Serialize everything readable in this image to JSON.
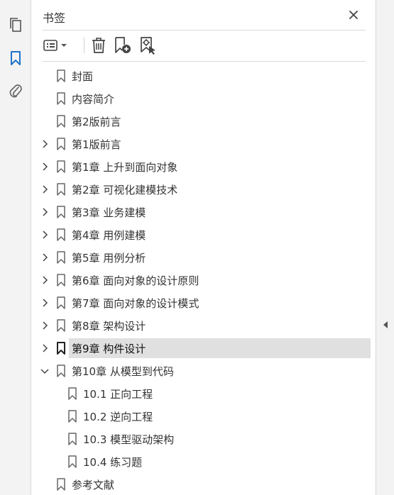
{
  "panel": {
    "title": "书签"
  },
  "colors": {
    "rail_bg": "#f3f3f3",
    "active_icon": "#1e73c8",
    "selected_row_bg": "#e0e0e0"
  },
  "rail": {
    "icons": [
      "pages-icon",
      "bookmarks-icon",
      "attachments-icon"
    ],
    "active": "bookmarks-icon"
  },
  "toolbar": {
    "icons": [
      "options-menu-icon",
      "delete-icon",
      "new-bookmark-icon",
      "new-bookmark-from-structure-icon"
    ]
  },
  "bookmarks": [
    {
      "label": "封面",
      "level": 0,
      "expander": "none"
    },
    {
      "label": "内容简介",
      "level": 0,
      "expander": "none"
    },
    {
      "label": "第2版前言",
      "level": 0,
      "expander": "none"
    },
    {
      "label": "第1版前言",
      "level": 0,
      "expander": "collapsed"
    },
    {
      "label": "第1章 上升到面向对象",
      "level": 0,
      "expander": "collapsed"
    },
    {
      "label": "第2章 可视化建模技术",
      "level": 0,
      "expander": "collapsed"
    },
    {
      "label": "第3章 业务建模",
      "level": 0,
      "expander": "collapsed"
    },
    {
      "label": "第4章 用例建模",
      "level": 0,
      "expander": "collapsed"
    },
    {
      "label": "第5章 用例分析",
      "level": 0,
      "expander": "collapsed"
    },
    {
      "label": "第6章 面向对象的设计原则",
      "level": 0,
      "expander": "collapsed"
    },
    {
      "label": "第7章 面向对象的设计模式",
      "level": 0,
      "expander": "collapsed"
    },
    {
      "label": "第8章 架构设计",
      "level": 0,
      "expander": "collapsed"
    },
    {
      "label": "第9章 构件设计",
      "level": 0,
      "expander": "collapsed",
      "selected": true
    },
    {
      "label": "第10章 从模型到代码",
      "level": 0,
      "expander": "expanded"
    },
    {
      "label": "10.1 正向工程",
      "level": 1,
      "expander": "none"
    },
    {
      "label": "10.2 逆向工程",
      "level": 1,
      "expander": "none"
    },
    {
      "label": "10.3 模型驱动架构",
      "level": 1,
      "expander": "none"
    },
    {
      "label": "10.4 练习题",
      "level": 1,
      "expander": "none"
    },
    {
      "label": "参考文献",
      "level": 0,
      "expander": "none"
    }
  ]
}
